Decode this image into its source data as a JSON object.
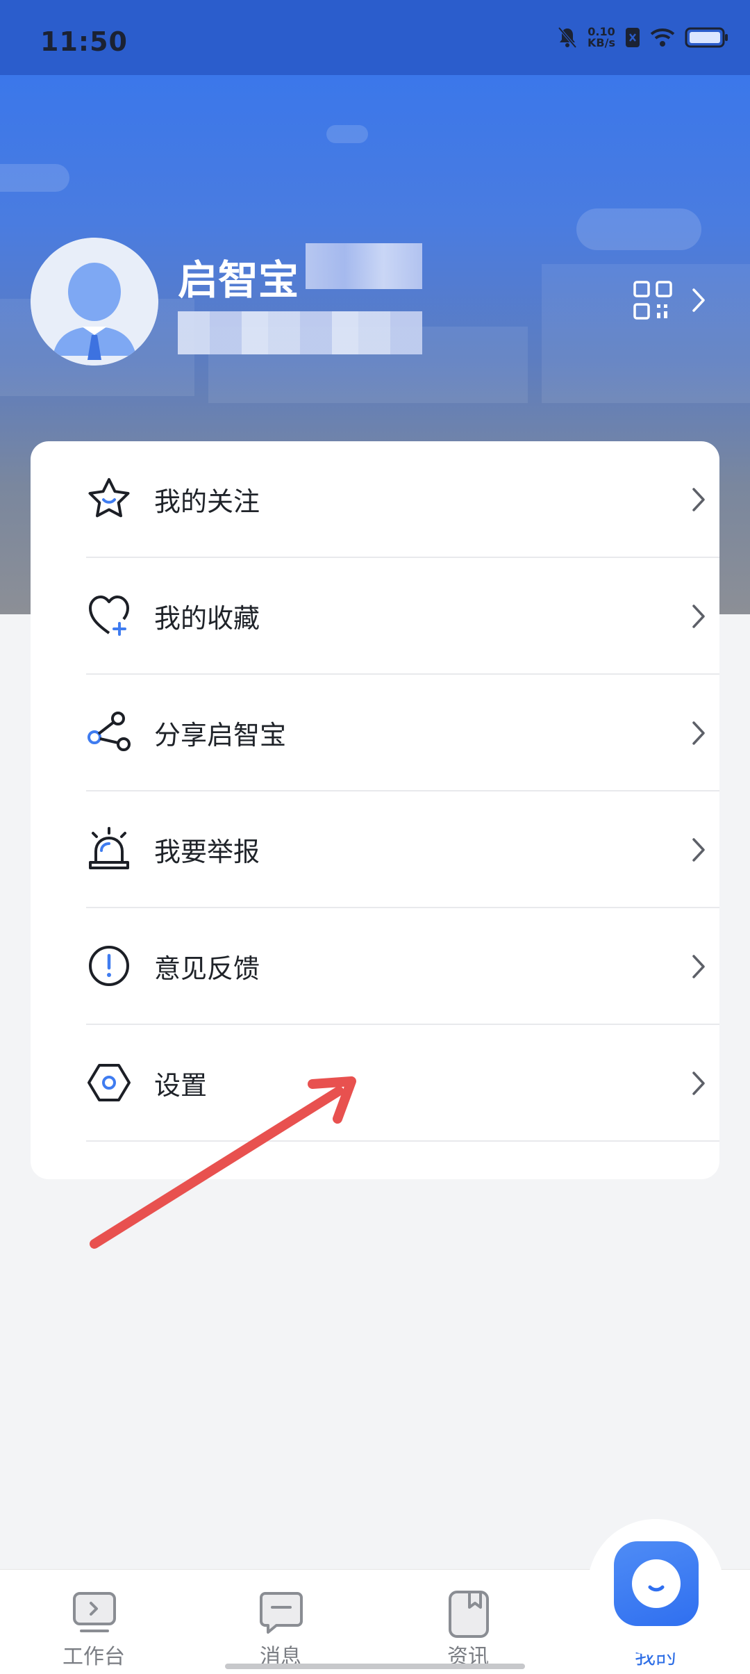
{
  "status_bar": {
    "time": "11:50",
    "speed_value": "0.10",
    "speed_unit": "KB/s"
  },
  "profile": {
    "name": "启智宝"
  },
  "menu": [
    {
      "label": "我的关注",
      "icon": "star-icon"
    },
    {
      "label": "我的收藏",
      "icon": "heart-plus-icon"
    },
    {
      "label": "分享启智宝",
      "icon": "share-icon"
    },
    {
      "label": "我要举报",
      "icon": "alarm-icon"
    },
    {
      "label": "意见反馈",
      "icon": "exclamation-circle-icon"
    },
    {
      "label": "设置",
      "icon": "hexagon-gear-icon"
    }
  ],
  "bottom_nav": [
    {
      "label": "工作台",
      "icon": "workbench-icon"
    },
    {
      "label": "消息",
      "icon": "message-icon"
    },
    {
      "label": "资讯",
      "icon": "news-icon"
    },
    {
      "label": "我的",
      "icon": "profile-face-icon",
      "active": true
    }
  ],
  "colors": {
    "accent": "#2e6ee6",
    "annotation_arrow": "#e8514f",
    "header_blue": "#3b77ea"
  }
}
